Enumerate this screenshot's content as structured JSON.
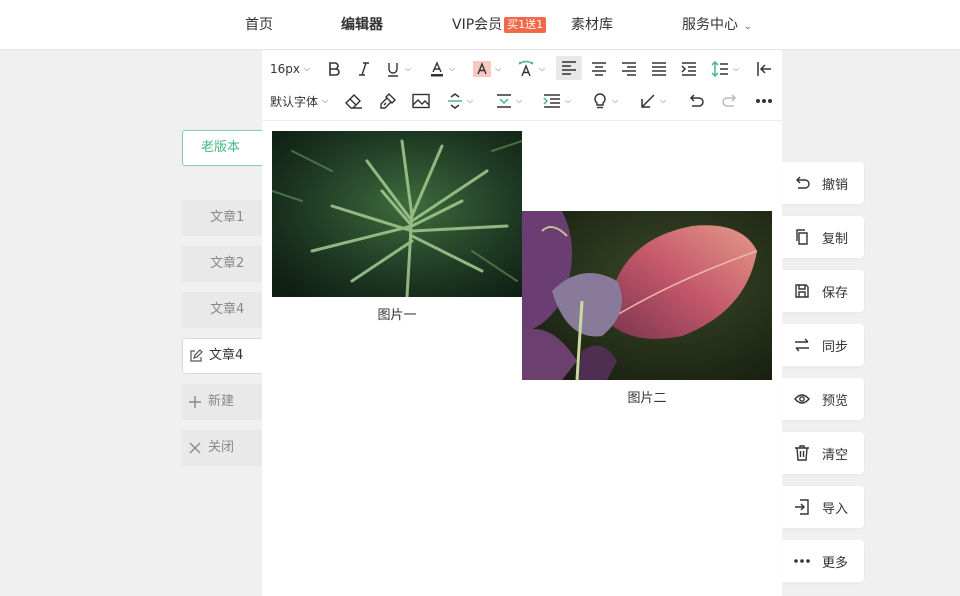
{
  "nav": {
    "home": "首页",
    "editor": "编辑器",
    "vip": "VIP会员",
    "vip_badge": "买1送1",
    "materials": "素材库",
    "service": "服务中心"
  },
  "sidebar": {
    "old_version": "老版本",
    "docs": [
      "文章1",
      "文章2",
      "文章4",
      "文章4"
    ],
    "new_label": "新建",
    "close_label": "关闭"
  },
  "toolbar": {
    "font_size": "16px",
    "font_family": "默认字体"
  },
  "content": {
    "caption1": "图片一",
    "caption2": "图片二"
  },
  "actions": [
    "撤销",
    "复制",
    "保存",
    "同步",
    "预览",
    "清空",
    "导入",
    "更多"
  ],
  "colors": {
    "accent_green": "#45b884",
    "badge_red": "#f4684a",
    "bg": "#f0f0f0"
  }
}
